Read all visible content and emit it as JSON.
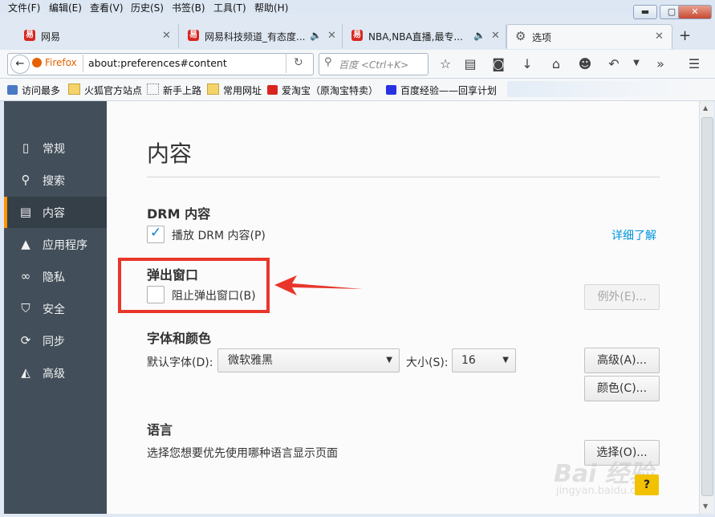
{
  "menubar": {
    "items": [
      "文件(F)",
      "编辑(E)",
      "查看(V)",
      "历史(S)",
      "书签(B)",
      "工具(T)",
      "帮助(H)"
    ]
  },
  "window_controls": {
    "minimize": "▬",
    "maximize": "▢",
    "close": "✕"
  },
  "tabs": [
    {
      "title": "网易",
      "favicon": "易"
    },
    {
      "title": "网易科技频道_有态度...",
      "favicon": "易"
    },
    {
      "title": "NBA,NBA直播,最专...",
      "favicon": "易"
    },
    {
      "title": "选项",
      "favicon": "gear-icon"
    }
  ],
  "new_tab_label": "+",
  "navbar": {
    "identity_label": "Firefox",
    "url": "about:preferences#content",
    "search_placeholder": "百度 <Ctrl+K>"
  },
  "bookmarks": [
    {
      "label": "访问最多",
      "icon": "most-visited-icon"
    },
    {
      "label": "火狐官方站点",
      "icon": "folder-icon"
    },
    {
      "label": "新手上路",
      "icon": "page-icon"
    },
    {
      "label": "常用网址",
      "icon": "folder-icon"
    },
    {
      "label": "爱淘宝（原淘宝特卖）",
      "icon": "taobao-icon"
    },
    {
      "label": "百度经验——回享计划",
      "icon": "baidu-icon"
    }
  ],
  "sidebar": {
    "items": [
      {
        "label": "常规",
        "icon": "general-icon"
      },
      {
        "label": "搜索",
        "icon": "search-icon"
      },
      {
        "label": "内容",
        "icon": "content-icon"
      },
      {
        "label": "应用程序",
        "icon": "applications-icon"
      },
      {
        "label": "隐私",
        "icon": "privacy-icon"
      },
      {
        "label": "安全",
        "icon": "security-icon"
      },
      {
        "label": "同步",
        "icon": "sync-icon"
      },
      {
        "label": "高级",
        "icon": "advanced-icon"
      }
    ],
    "active_index": 2
  },
  "main": {
    "title": "内容",
    "drm": {
      "heading": "DRM 内容",
      "checkbox_label": "播放 DRM 内容(P)",
      "checked": true,
      "learn_more": "详细了解"
    },
    "popups": {
      "heading": "弹出窗口",
      "checkbox_label": "阻止弹出窗口(B)",
      "checked": false,
      "exceptions_button": "例外(E)..."
    },
    "fonts": {
      "heading": "字体和颜色",
      "default_font_label": "默认字体(D):",
      "default_font_value": "微软雅黑",
      "size_label": "大小(S):",
      "size_value": "16",
      "advanced_button": "高级(A)...",
      "colors_button": "颜色(C)..."
    },
    "language": {
      "heading": "语言",
      "description": "选择您想要优先使用哪种语言显示页面",
      "choose_button": "选择(O)..."
    }
  },
  "help_button": "?",
  "watermark": {
    "text": "Bai 经验",
    "sub": "jingyan.baidu.com"
  },
  "colors": {
    "accent": "#ff9500",
    "sidebar_bg": "#424f5a",
    "annotation_red": "#e8362b",
    "link": "#0095dd"
  }
}
